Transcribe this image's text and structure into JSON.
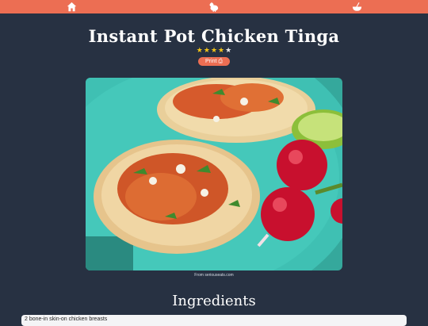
{
  "nav": {
    "items": [
      {
        "icon": "home-icon"
      },
      {
        "icon": "chicken-icon"
      },
      {
        "icon": "mixing-bowl-icon"
      }
    ]
  },
  "recipe": {
    "title": "Instant Pot Chicken Tinga",
    "rating": 4,
    "rating_max": 5,
    "print_label": "Print",
    "image_credit": "From seriouseats.com"
  },
  "ingredients": {
    "heading": "Ingredients",
    "items": [
      "2 bone-in skin-on chicken breasts"
    ]
  },
  "colors": {
    "accent": "#ec6e53",
    "background": "#273142",
    "star_filled": "#f5c518",
    "star_empty": "#e8e8e8"
  }
}
